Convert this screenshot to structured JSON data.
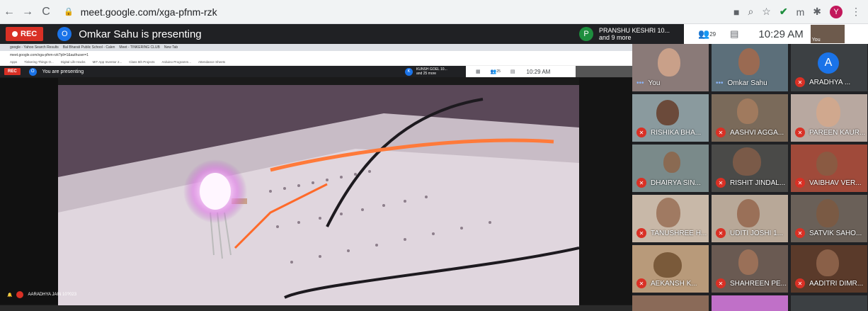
{
  "browser": {
    "url": "meet.google.com/xga-pfnm-rzk",
    "nav_icons": [
      "←",
      "→",
      "C"
    ]
  },
  "meet": {
    "rec_label": "REC",
    "presenter_initial": "O",
    "presenting_text": "Omkar Sahu is presenting",
    "participant_initial": "P",
    "participant_line1": "PRANSHU KESHRI 10...",
    "participant_line2": "and 9 more",
    "people_count": "29",
    "time": "10:29 AM",
    "self_label": "You"
  },
  "shared_screen": {
    "tabs": [
      "google - Yahoo Search Results",
      "Bal Bharati Public School - Calen",
      "Meet - TINKERING CLUB",
      "New Tab"
    ],
    "url": "meet.google.com/xga-pfnm-rzk?pli=1&authuser=1",
    "bookmarks": [
      "Apps",
      "Tinkering Things O...",
      "Digital Life Hacks",
      "MIT App Inventor 2...",
      "Class 5th Projects",
      "Arduino Programm...",
      "Attendance Sheets"
    ],
    "rec_label": "REC",
    "presenter_initial": "O",
    "presenting_text": "You are presenting",
    "participant_initial": "K",
    "participant_line1": "KUNSH GOEL 10...",
    "participant_line2": "and 25 more",
    "people_count": "25",
    "time": "10:29 AM",
    "bottom_name": "AARADHYA JAIN 10?023"
  },
  "participants": [
    {
      "name": "You",
      "initial": ""
    },
    {
      "name": "Omkar Sahu",
      "initial": ""
    },
    {
      "name": "ARADHYA ...",
      "initial": "A"
    },
    {
      "name": "RISHIKA BHA...",
      "initial": ""
    },
    {
      "name": "AASHVI AGGA...",
      "initial": ""
    },
    {
      "name": "PAREEN KAUR...",
      "initial": ""
    },
    {
      "name": "DHAIRYA SIN...",
      "initial": ""
    },
    {
      "name": "RISHIT JINDAL...",
      "initial": ""
    },
    {
      "name": "VAIBHAV VER...",
      "initial": ""
    },
    {
      "name": "TANUSHREE H...",
      "initial": ""
    },
    {
      "name": "UDITI JOSHI 1...",
      "initial": ""
    },
    {
      "name": "SATVIK SAHO...",
      "initial": ""
    },
    {
      "name": "AEKANSH K...",
      "initial": ""
    },
    {
      "name": "SHAHREEN PE...",
      "initial": ""
    },
    {
      "name": "AADITRI DIMR...",
      "initial": ""
    }
  ]
}
